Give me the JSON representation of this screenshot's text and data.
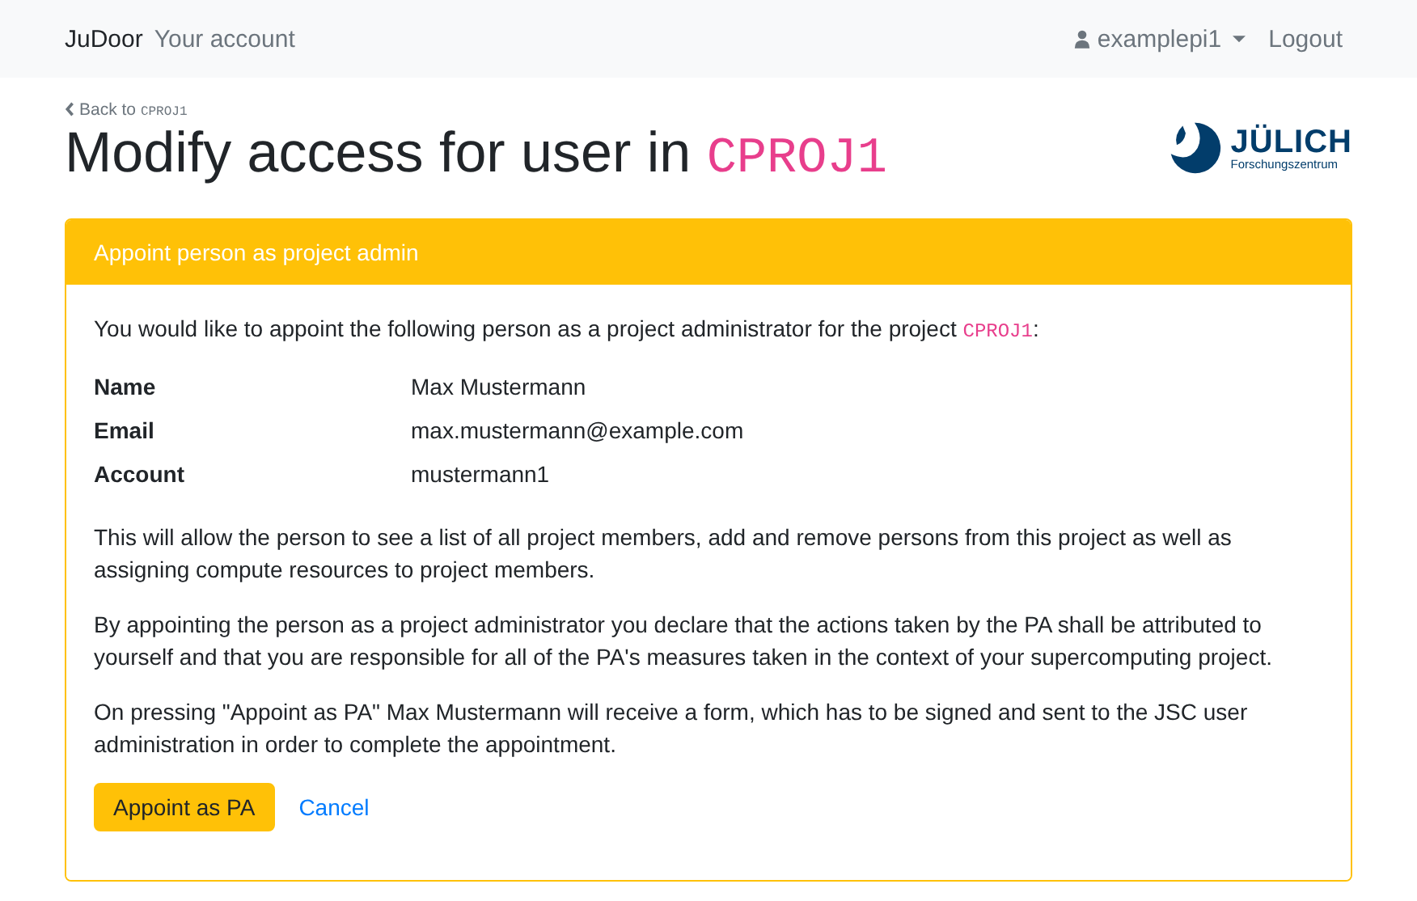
{
  "navbar": {
    "brand": "JuDoor",
    "links": [
      {
        "label": "Your account"
      }
    ],
    "user": "examplepi1",
    "logout": "Logout"
  },
  "back_link": {
    "text": "Back to ",
    "project": "CPROJ1"
  },
  "title": {
    "text": "Modify access for user in ",
    "project": "CPROJ1"
  },
  "logo": {
    "name": "JÜLICH",
    "subtitle": "Forschungszentrum"
  },
  "card": {
    "header": "Appoint person as project admin",
    "intro": {
      "text": "You would like to appoint the following person as a project administrator for the project ",
      "project": "CPROJ1",
      "suffix": ":"
    },
    "details": [
      {
        "label": "Name",
        "value": "Max Mustermann"
      },
      {
        "label": "Email",
        "value": "max.mustermann@example.com"
      },
      {
        "label": "Account",
        "value": "mustermann1"
      }
    ],
    "paragraphs": [
      "This will allow the person to see a list of all project members, add and remove persons from this project as well as assigning compute resources to project members.",
      "By appointing the person as a project administrator you declare that the actions taken by the PA shall be attributed to yourself and that you are responsible for all of the PA's measures taken in the context of your supercomputing project.",
      "On pressing \"Appoint as PA\" Max Mustermann will receive a form, which has to be signed and sent to the JSC user administration in order to complete the appointment."
    ],
    "primary_button": "Appoint as PA",
    "cancel": "Cancel"
  }
}
